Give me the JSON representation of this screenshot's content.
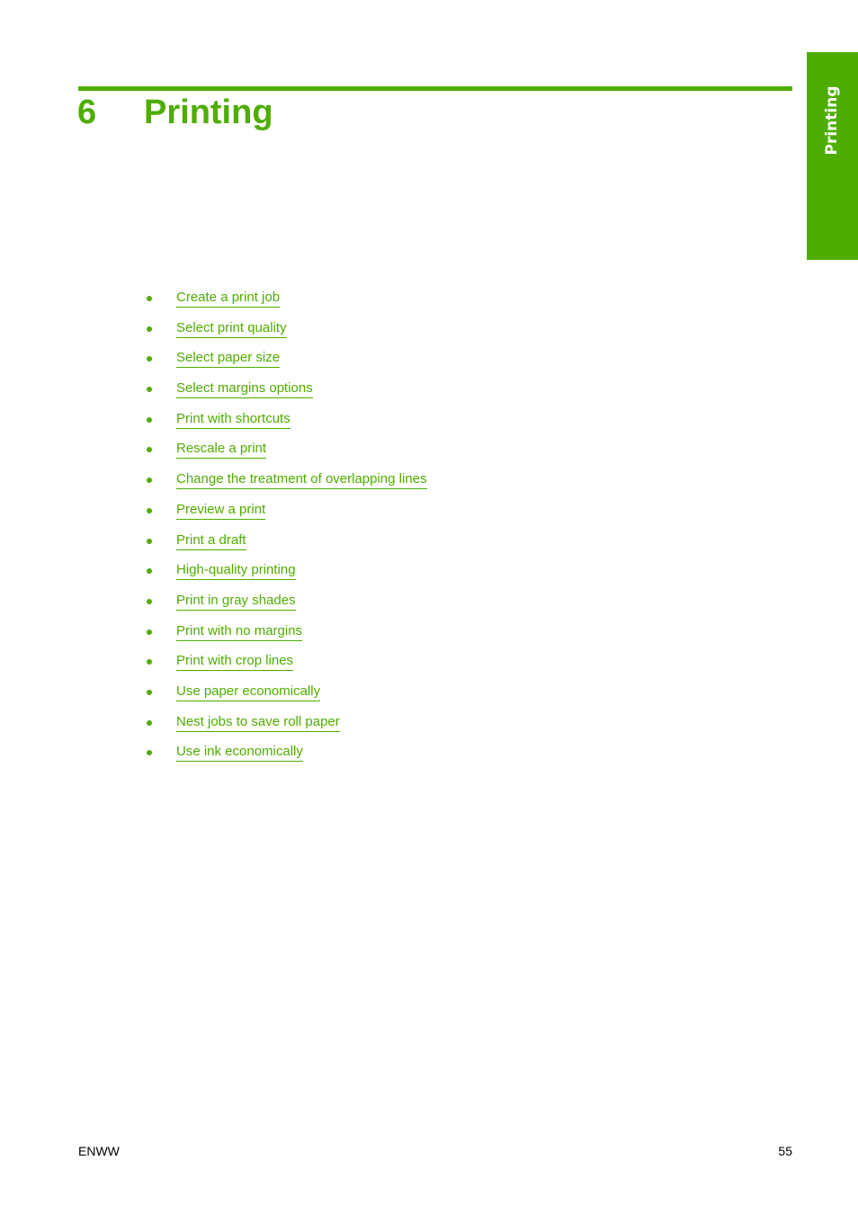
{
  "colors": {
    "accent": "#4fad00",
    "text": "#000000",
    "background": "#ffffff"
  },
  "chapter": {
    "number": "6",
    "title": "Printing"
  },
  "side_tab": {
    "label": "Printing"
  },
  "toc": {
    "items": [
      {
        "label": "Create a print job"
      },
      {
        "label": "Select print quality"
      },
      {
        "label": "Select paper size"
      },
      {
        "label": "Select margins options"
      },
      {
        "label": "Print with shortcuts"
      },
      {
        "label": "Rescale a print"
      },
      {
        "label": "Change the treatment of overlapping lines"
      },
      {
        "label": "Preview a print"
      },
      {
        "label": "Print a draft"
      },
      {
        "label": "High-quality printing"
      },
      {
        "label": "Print in gray shades"
      },
      {
        "label": "Print with no margins"
      },
      {
        "label": "Print with crop lines"
      },
      {
        "label": "Use paper economically"
      },
      {
        "label": "Nest jobs to save roll paper"
      },
      {
        "label": "Use ink economically"
      }
    ]
  },
  "footer": {
    "left": "ENWW",
    "page_number": "55"
  }
}
